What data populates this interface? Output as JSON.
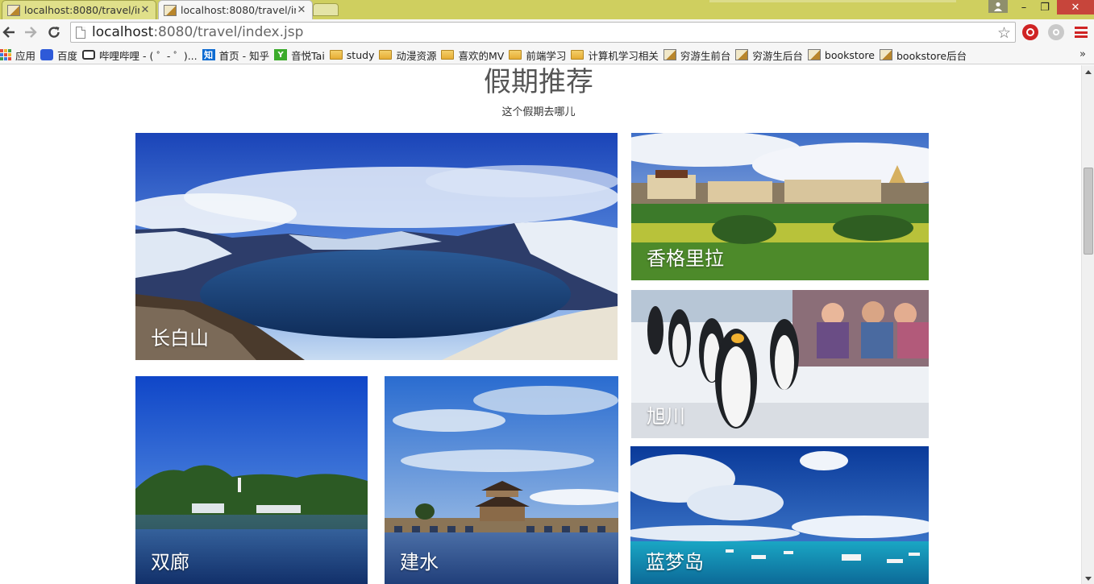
{
  "browser": {
    "tabs": [
      {
        "title": "localhost:8080/travel/in",
        "close": "✕",
        "active": false
      },
      {
        "title": "localhost:8080/travel/in",
        "close": "✕",
        "active": true
      }
    ],
    "url_host": "localhost",
    "url_path": ":8080/travel/index.jsp",
    "window_controls": {
      "minimize": "–",
      "maximize": "❐",
      "close": "✕"
    },
    "bookmarks": [
      {
        "label": "应用",
        "icon": "apps-icon"
      },
      {
        "label": "百度",
        "icon": "baidu-icon"
      },
      {
        "label": "哔哩哔哩 - ( ゜- ゜)...",
        "icon": "bilibili-icon"
      },
      {
        "label": "首页 - 知乎",
        "icon": "zhihu-icon"
      },
      {
        "label": "音悦Tai",
        "icon": "yinyuetai-icon"
      },
      {
        "label": "study",
        "icon": "folder-icon"
      },
      {
        "label": "动漫资源",
        "icon": "folder-icon"
      },
      {
        "label": "喜欢的MV",
        "icon": "folder-icon"
      },
      {
        "label": "前端学习",
        "icon": "folder-icon"
      },
      {
        "label": "计算机学习相关",
        "icon": "folder-icon"
      },
      {
        "label": "穷游生前台",
        "icon": "page-icon"
      },
      {
        "label": "穷游生后台",
        "icon": "page-icon"
      },
      {
        "label": "bookstore",
        "icon": "page-icon"
      },
      {
        "label": "bookstore后台",
        "icon": "page-icon"
      }
    ],
    "bookmarks_more": "»"
  },
  "page": {
    "title": "假期推荐",
    "subtitle": "这个假期去哪儿",
    "destinations": [
      {
        "name": "长白山"
      },
      {
        "name": "香格里拉"
      },
      {
        "name": "旭川"
      },
      {
        "name": "双廊"
      },
      {
        "name": "建水"
      },
      {
        "name": "蓝梦岛"
      }
    ]
  },
  "colors": {
    "tabstrip": "#cfcf5f",
    "accent_red": "#cf2323",
    "card_label": "#ffffff"
  }
}
